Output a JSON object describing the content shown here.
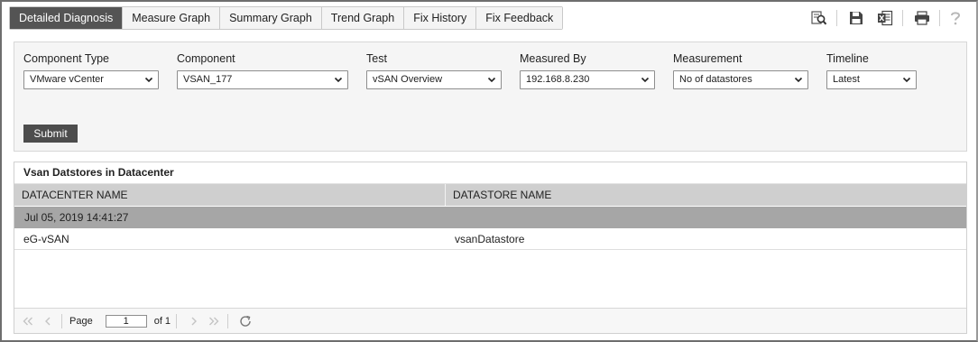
{
  "tabs": [
    {
      "label": "Detailed Diagnosis",
      "active": true
    },
    {
      "label": "Measure Graph",
      "active": false
    },
    {
      "label": "Summary Graph",
      "active": false
    },
    {
      "label": "Trend Graph",
      "active": false
    },
    {
      "label": "Fix History",
      "active": false
    },
    {
      "label": "Fix Feedback",
      "active": false
    }
  ],
  "toolbar_icons": [
    "search-report-icon",
    "save-icon",
    "excel-export-icon",
    "print-icon",
    "help-icon"
  ],
  "filters": {
    "component_type": {
      "label": "Component Type",
      "value": "VMware vCenter"
    },
    "component": {
      "label": "Component",
      "value": "VSAN_177"
    },
    "test": {
      "label": "Test",
      "value": "vSAN Overview"
    },
    "measured_by": {
      "label": "Measured By",
      "value": "192.168.8.230"
    },
    "measurement": {
      "label": "Measurement",
      "value": "No of datastores"
    },
    "timeline": {
      "label": "Timeline",
      "value": "Latest"
    },
    "submit_label": "Submit"
  },
  "results": {
    "title": "Vsan Datstores in Datacenter",
    "columns": [
      "DATACENTER NAME",
      "DATASTORE NAME"
    ],
    "group_timestamp": "Jul 05, 2019 14:41:27",
    "rows": [
      {
        "datacenter": "eG-vSAN",
        "datastore": "vsanDatastore"
      }
    ]
  },
  "pager": {
    "page_label": "Page",
    "page_value": "1",
    "of_label": "of 1"
  },
  "colors": {
    "active_tab": "#545454",
    "header_row": "#cfcfcf",
    "group_row": "#a6a6a6",
    "submit": "#4d4d4d"
  }
}
